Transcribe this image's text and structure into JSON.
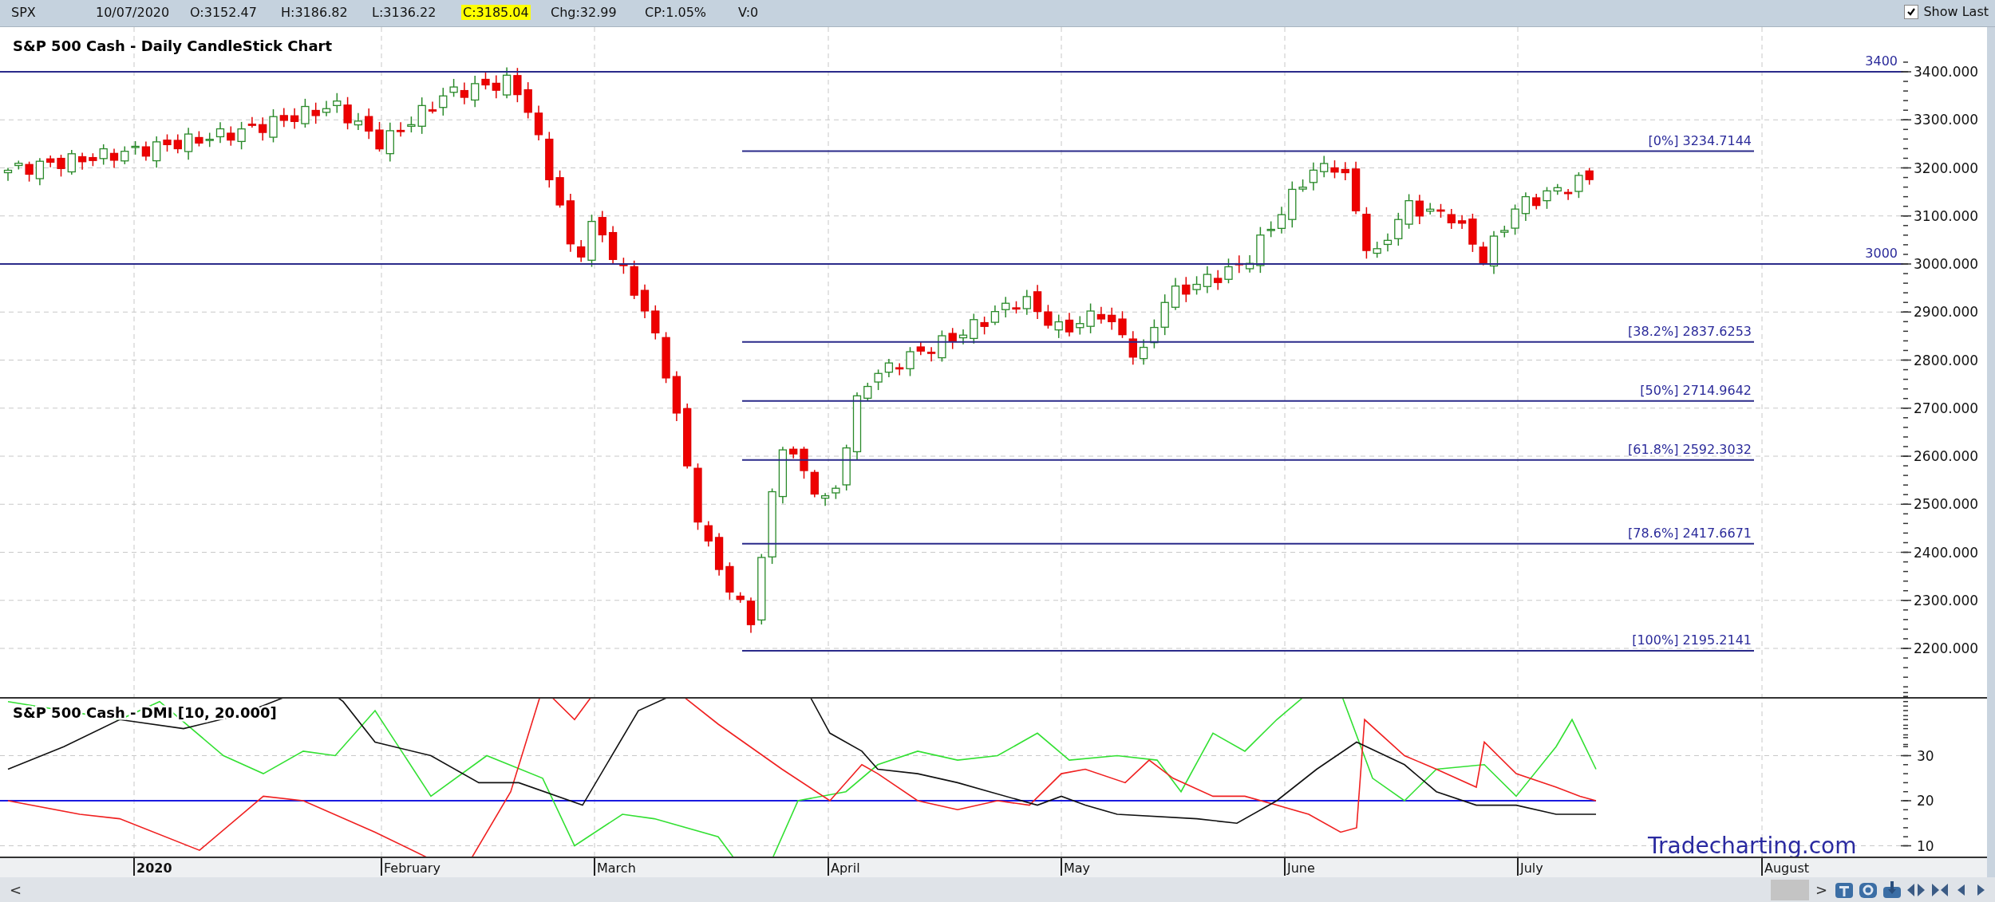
{
  "quote_bar": {
    "symbol": "SPX",
    "date": "10/07/2020",
    "open": "O:3152.47",
    "high": "H:3186.82",
    "low": "L:3136.22",
    "close": "C:3185.04",
    "change": "Chg:32.99",
    "change_pct": "CP:1.05%",
    "volume": "V:0"
  },
  "show_last": {
    "label": "Show Last",
    "checked": true
  },
  "price_chart": {
    "title": "S&P 500 Cash - Daily CandleStick Chart",
    "levels": [
      "3400",
      "3000"
    ],
    "fib_levels": [
      "[0%] 3234.7144",
      "[38.2%] 2837.6253",
      "[50%] 2714.9642",
      "[61.8%] 2592.3032",
      "[78.6%] 2417.6671",
      "[100%] 2195.2141"
    ],
    "y_tick_labels": [
      "3400.000",
      "3300.000",
      "3200.000",
      "3100.000",
      "3000.000",
      "2900.000",
      "2800.000",
      "2700.000",
      "2600.000",
      "2500.000",
      "2400.000",
      "2300.000",
      "2200.000"
    ]
  },
  "dmi_panel": {
    "title": "S&P 500 Cash - DMI [10, 20.000]",
    "y_tick_labels": [
      "30",
      "20",
      "10"
    ],
    "branding": "Tradecharting.com"
  },
  "x_axis_labels": [
    {
      "label": "2020",
      "kind": "year"
    },
    {
      "label": "February",
      "kind": "month"
    },
    {
      "label": "March",
      "kind": "month"
    },
    {
      "label": "April",
      "kind": "month"
    },
    {
      "label": "May",
      "kind": "month"
    },
    {
      "label": "June",
      "kind": "month"
    },
    {
      "label": "July",
      "kind": "month"
    },
    {
      "label": "August",
      "kind": "month"
    }
  ],
  "scrollbar": {
    "left": "<",
    "right": ">"
  }
}
